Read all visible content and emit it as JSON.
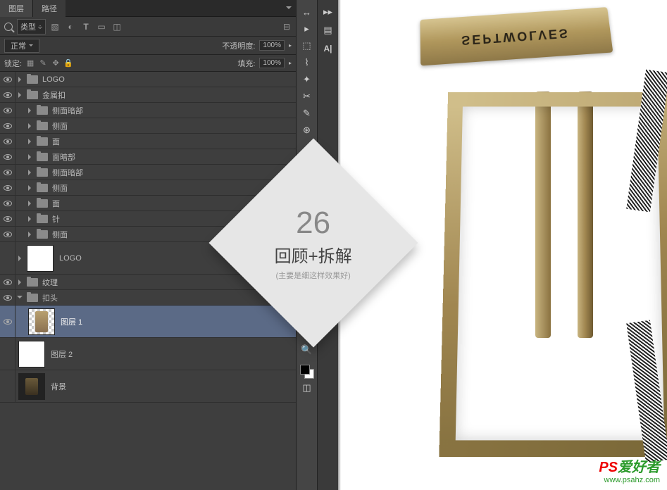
{
  "panel": {
    "tabs": {
      "layers": "图层",
      "paths": "路径"
    },
    "filter": {
      "kind_label": "类型"
    },
    "options": {
      "blend": "正常",
      "opacity_label": "不透明度:",
      "opacity_value": "100%"
    },
    "lock": {
      "label": "锁定:",
      "fill_label": "填充:",
      "fill_value": "100%"
    }
  },
  "layers": [
    {
      "name": "LOGO",
      "type": "folder",
      "indent": 0,
      "vis": true
    },
    {
      "name": "金属扣",
      "type": "folder",
      "indent": 0,
      "vis": true
    },
    {
      "name": "侧面暗部",
      "type": "folder",
      "indent": 1,
      "vis": true
    },
    {
      "name": "侧面",
      "type": "folder",
      "indent": 1,
      "vis": true
    },
    {
      "name": "面",
      "type": "folder",
      "indent": 1,
      "vis": true
    },
    {
      "name": "面暗部",
      "type": "folder",
      "indent": 1,
      "vis": true
    },
    {
      "name": "侧面暗部",
      "type": "folder",
      "indent": 1,
      "vis": true
    },
    {
      "name": "侧面",
      "type": "folder",
      "indent": 1,
      "vis": true
    },
    {
      "name": "面",
      "type": "folder",
      "indent": 1,
      "vis": true
    },
    {
      "name": "针",
      "type": "folder",
      "indent": 1,
      "vis": true
    },
    {
      "name": "侧面",
      "type": "folder",
      "indent": 1,
      "vis": true
    },
    {
      "name": "LOGO",
      "type": "layer-white",
      "indent": 0,
      "vis": false,
      "expandable": true
    },
    {
      "name": "纹理",
      "type": "folder",
      "indent": 0,
      "vis": true
    },
    {
      "name": "扣头",
      "type": "folder",
      "indent": 0,
      "vis": true,
      "open": true
    },
    {
      "name": "图层 1",
      "type": "layer-checker",
      "indent": 1,
      "vis": true,
      "selected": true
    },
    {
      "name": "图层 2",
      "type": "layer-white",
      "indent": 0,
      "vis": false
    },
    {
      "name": "背景",
      "type": "layer-dark",
      "indent": 0,
      "vis": false
    }
  ],
  "product": {
    "brand": "SEPTWOLVES"
  },
  "diamond": {
    "number": "26",
    "title": "回顾+拆解",
    "subtitle": "(主要是细这样效果好)"
  },
  "watermark": {
    "line1_a": "PS",
    "line1_b": "爱好者",
    "line2": "www.psahz.com"
  }
}
